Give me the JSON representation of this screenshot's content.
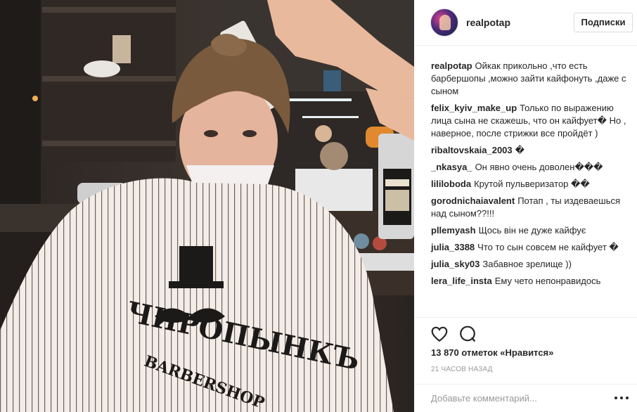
{
  "header": {
    "username": "realpotap",
    "follow_label": "Подписки"
  },
  "comments": [
    {
      "user": "realpotap",
      "text": "Ойкак прикольно ,что есть барбершопы ,можно зайти кайфонуть ,даже с сыном"
    },
    {
      "user": "felix_kyiv_make_up",
      "text": "Только по выражению лица сына не скажешь, что он кайфует� Но , наверное, после стрижки все пройдёт )"
    },
    {
      "user": "ribaltovskaia_2003",
      "text": "�"
    },
    {
      "user": "_nkasya_",
      "text": "Он явно очень доволен���"
    },
    {
      "user": "lililoboda",
      "text": "Крутой пульверизатор ��"
    },
    {
      "user": "gorodnichaiavalent",
      "text": "Потап , ты издеваешься над сыном??!!!"
    },
    {
      "user": "pllemyash",
      "text": "Щось він не дуже кайфує"
    },
    {
      "user": "julia_3388",
      "text": "Что то сын совсем не кайфует �"
    },
    {
      "user": "julia_sky03",
      "text": "Забавное зрелище ))"
    },
    {
      "user": "lera_life_insta",
      "text": "Ему чето непонравидось"
    }
  ],
  "actions": {
    "like_icon": "heart-outline-icon",
    "comment_icon": "comment-bubble-icon"
  },
  "likes_text": "13 870 отметок «Нравится»",
  "time_text": "21 ЧАСОВ НАЗАД",
  "add_comment": {
    "placeholder": "Добавьте комментарий..."
  },
  "cape_print": {
    "brand": "ЧИРОПЫНКЪ",
    "sub": "BARBERSHOP"
  },
  "colors": {
    "border": "#efefef",
    "text": "#262626",
    "muted": "#999999"
  }
}
